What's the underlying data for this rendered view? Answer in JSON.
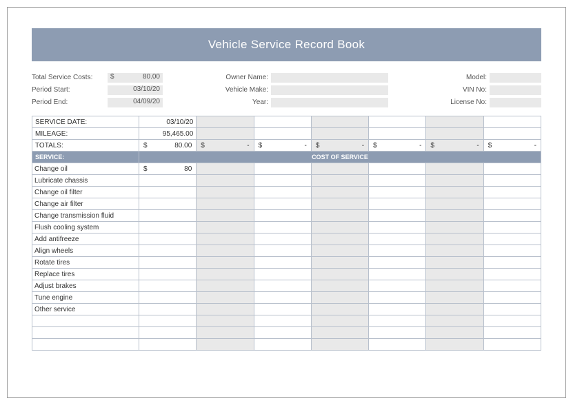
{
  "title": "Vehicle Service Record Book",
  "meta": {
    "left": [
      {
        "label": "Total Service Costs:",
        "currency": "$",
        "value": "80.00"
      },
      {
        "label": "Period Start:",
        "currency": "",
        "value": "03/10/20"
      },
      {
        "label": "Period End:",
        "currency": "",
        "value": "04/09/20"
      }
    ],
    "center": [
      {
        "label": "Owner Name:"
      },
      {
        "label": "Vehicle Make:"
      },
      {
        "label": "Year:"
      }
    ],
    "right": [
      {
        "label": "Model:"
      },
      {
        "label": "VIN No:"
      },
      {
        "label": "License No:"
      }
    ]
  },
  "header_rows": {
    "service_date": {
      "label": "SERVICE DATE:",
      "value": "03/10/20"
    },
    "mileage": {
      "label": "MILEAGE:",
      "value": "95,465.00"
    },
    "totals": {
      "label": "TOTALS:",
      "currency": "$",
      "value": "80.00",
      "dash": "-"
    }
  },
  "section_header": {
    "service": "SERVICE:",
    "cost": "COST OF SERVICE"
  },
  "services": [
    {
      "name": "Change oil",
      "currency": "$",
      "amount": "80"
    },
    {
      "name": "Lubricate chassis",
      "currency": "",
      "amount": ""
    },
    {
      "name": "Change oil filter",
      "currency": "",
      "amount": ""
    },
    {
      "name": "Change air filter",
      "currency": "",
      "amount": ""
    },
    {
      "name": "Change transmission fluid",
      "currency": "",
      "amount": ""
    },
    {
      "name": "Flush cooling system",
      "currency": "",
      "amount": ""
    },
    {
      "name": "Add antifreeze",
      "currency": "",
      "amount": ""
    },
    {
      "name": "Align wheels",
      "currency": "",
      "amount": ""
    },
    {
      "name": "Rotate tires",
      "currency": "",
      "amount": ""
    },
    {
      "name": "Replace tires",
      "currency": "",
      "amount": ""
    },
    {
      "name": "Adjust brakes",
      "currency": "",
      "amount": ""
    },
    {
      "name": "Tune engine",
      "currency": "",
      "amount": ""
    },
    {
      "name": "Other service",
      "currency": "",
      "amount": ""
    },
    {
      "name": "",
      "currency": "",
      "amount": ""
    },
    {
      "name": "",
      "currency": "",
      "amount": ""
    },
    {
      "name": "",
      "currency": "",
      "amount": ""
    }
  ],
  "num_cost_columns": 7
}
